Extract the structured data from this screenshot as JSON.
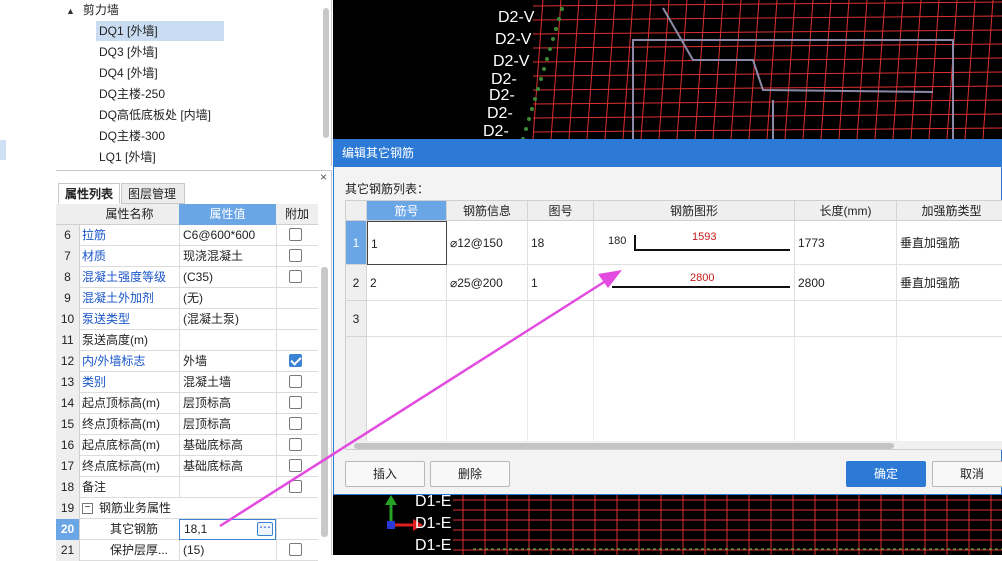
{
  "tree": {
    "root_label": "剪力墙",
    "items": [
      {
        "label": "DQ1 [外墙]",
        "selected": true
      },
      {
        "label": "DQ3 [外墙]"
      },
      {
        "label": "DQ4 [外墙]"
      },
      {
        "label": "DQ主楼-250"
      },
      {
        "label": "DQ高低底板处 [内墙]"
      },
      {
        "label": "DQ主楼-300"
      },
      {
        "label": "LQ1 [外墙]"
      }
    ]
  },
  "props": {
    "close": "×",
    "tabs": [
      "属性列表",
      "图层管理"
    ],
    "headers": [
      "属性名称",
      "属性值",
      "附加"
    ],
    "rows": [
      {
        "n": "6",
        "name": "拉筋",
        "value": "C6@600*600",
        "blue": true,
        "check": false
      },
      {
        "n": "7",
        "name": "材质",
        "value": "现浇混凝土",
        "blue": true,
        "check": false
      },
      {
        "n": "8",
        "name": "混凝土强度等级",
        "value": "(C35)",
        "blue": true,
        "check": false
      },
      {
        "n": "9",
        "name": "混凝土外加剂",
        "value": "(无)",
        "blue": true,
        "check": null
      },
      {
        "n": "10",
        "name": "泵送类型",
        "value": "(混凝土泵)",
        "blue": true,
        "check": null
      },
      {
        "n": "11",
        "name": "泵送高度(m)",
        "value": "",
        "blue": false,
        "check": null
      },
      {
        "n": "12",
        "name": "内/外墙标志",
        "value": "外墙",
        "blue": true,
        "check": true
      },
      {
        "n": "13",
        "name": "类别",
        "value": "混凝土墙",
        "blue": true,
        "check": false
      },
      {
        "n": "14",
        "name": "起点顶标高(m)",
        "value": "层顶标高",
        "blue": false,
        "check": false
      },
      {
        "n": "15",
        "name": "终点顶标高(m)",
        "value": "层顶标高",
        "blue": false,
        "check": false
      },
      {
        "n": "16",
        "name": "起点底标高(m)",
        "value": "基础底标高",
        "blue": false,
        "check": false
      },
      {
        "n": "17",
        "name": "终点底标高(m)",
        "value": "基础底标高",
        "blue": false,
        "check": false
      },
      {
        "n": "18",
        "name": "备注",
        "value": "",
        "blue": false,
        "check": false
      }
    ],
    "group_row": {
      "n": "19",
      "name": "钢筋业务属性",
      "expander": "−"
    },
    "edit_row": {
      "n": "20",
      "name": "其它钢筋",
      "value": "18,1",
      "dots": "⋯"
    },
    "last_row": {
      "n": "21",
      "name": "保护层厚...",
      "value": "(15)"
    }
  },
  "dialog": {
    "title": "编辑其它钢筋",
    "subtitle": "其它钢筋列表：",
    "columns": [
      "筋号",
      "钢筋信息",
      "图号",
      "钢筋图形",
      "长度(mm)",
      "加强筋类型"
    ],
    "rows": [
      {
        "n": "1",
        "no": "1",
        "info": "⌀12@150",
        "fig": "18",
        "shape_left": "180",
        "shape_mid": "1593",
        "length": "1773",
        "type": "垂直加强筋"
      },
      {
        "n": "2",
        "no": "2",
        "info": "⌀25@200",
        "fig": "1",
        "shape_left": "",
        "shape_mid": "2800",
        "length": "2800",
        "type": "垂直加强筋"
      },
      {
        "n": "3",
        "no": "",
        "info": "",
        "fig": "",
        "shape_left": "",
        "shape_mid": "",
        "length": "",
        "type": ""
      }
    ],
    "buttons": {
      "insert": "插入",
      "delete": "删除",
      "ok": "确定",
      "cancel": "取消"
    }
  },
  "cad_labels": [
    "D2-V",
    "D2-V",
    "D2-V",
    "D2-",
    "D2-",
    "D2-",
    "D2-",
    "D1-E",
    "D1-E",
    "D1-E"
  ],
  "colors": {
    "accent": "#2d7ad6",
    "grid": "#e03030",
    "arrow": "#e34be0"
  }
}
